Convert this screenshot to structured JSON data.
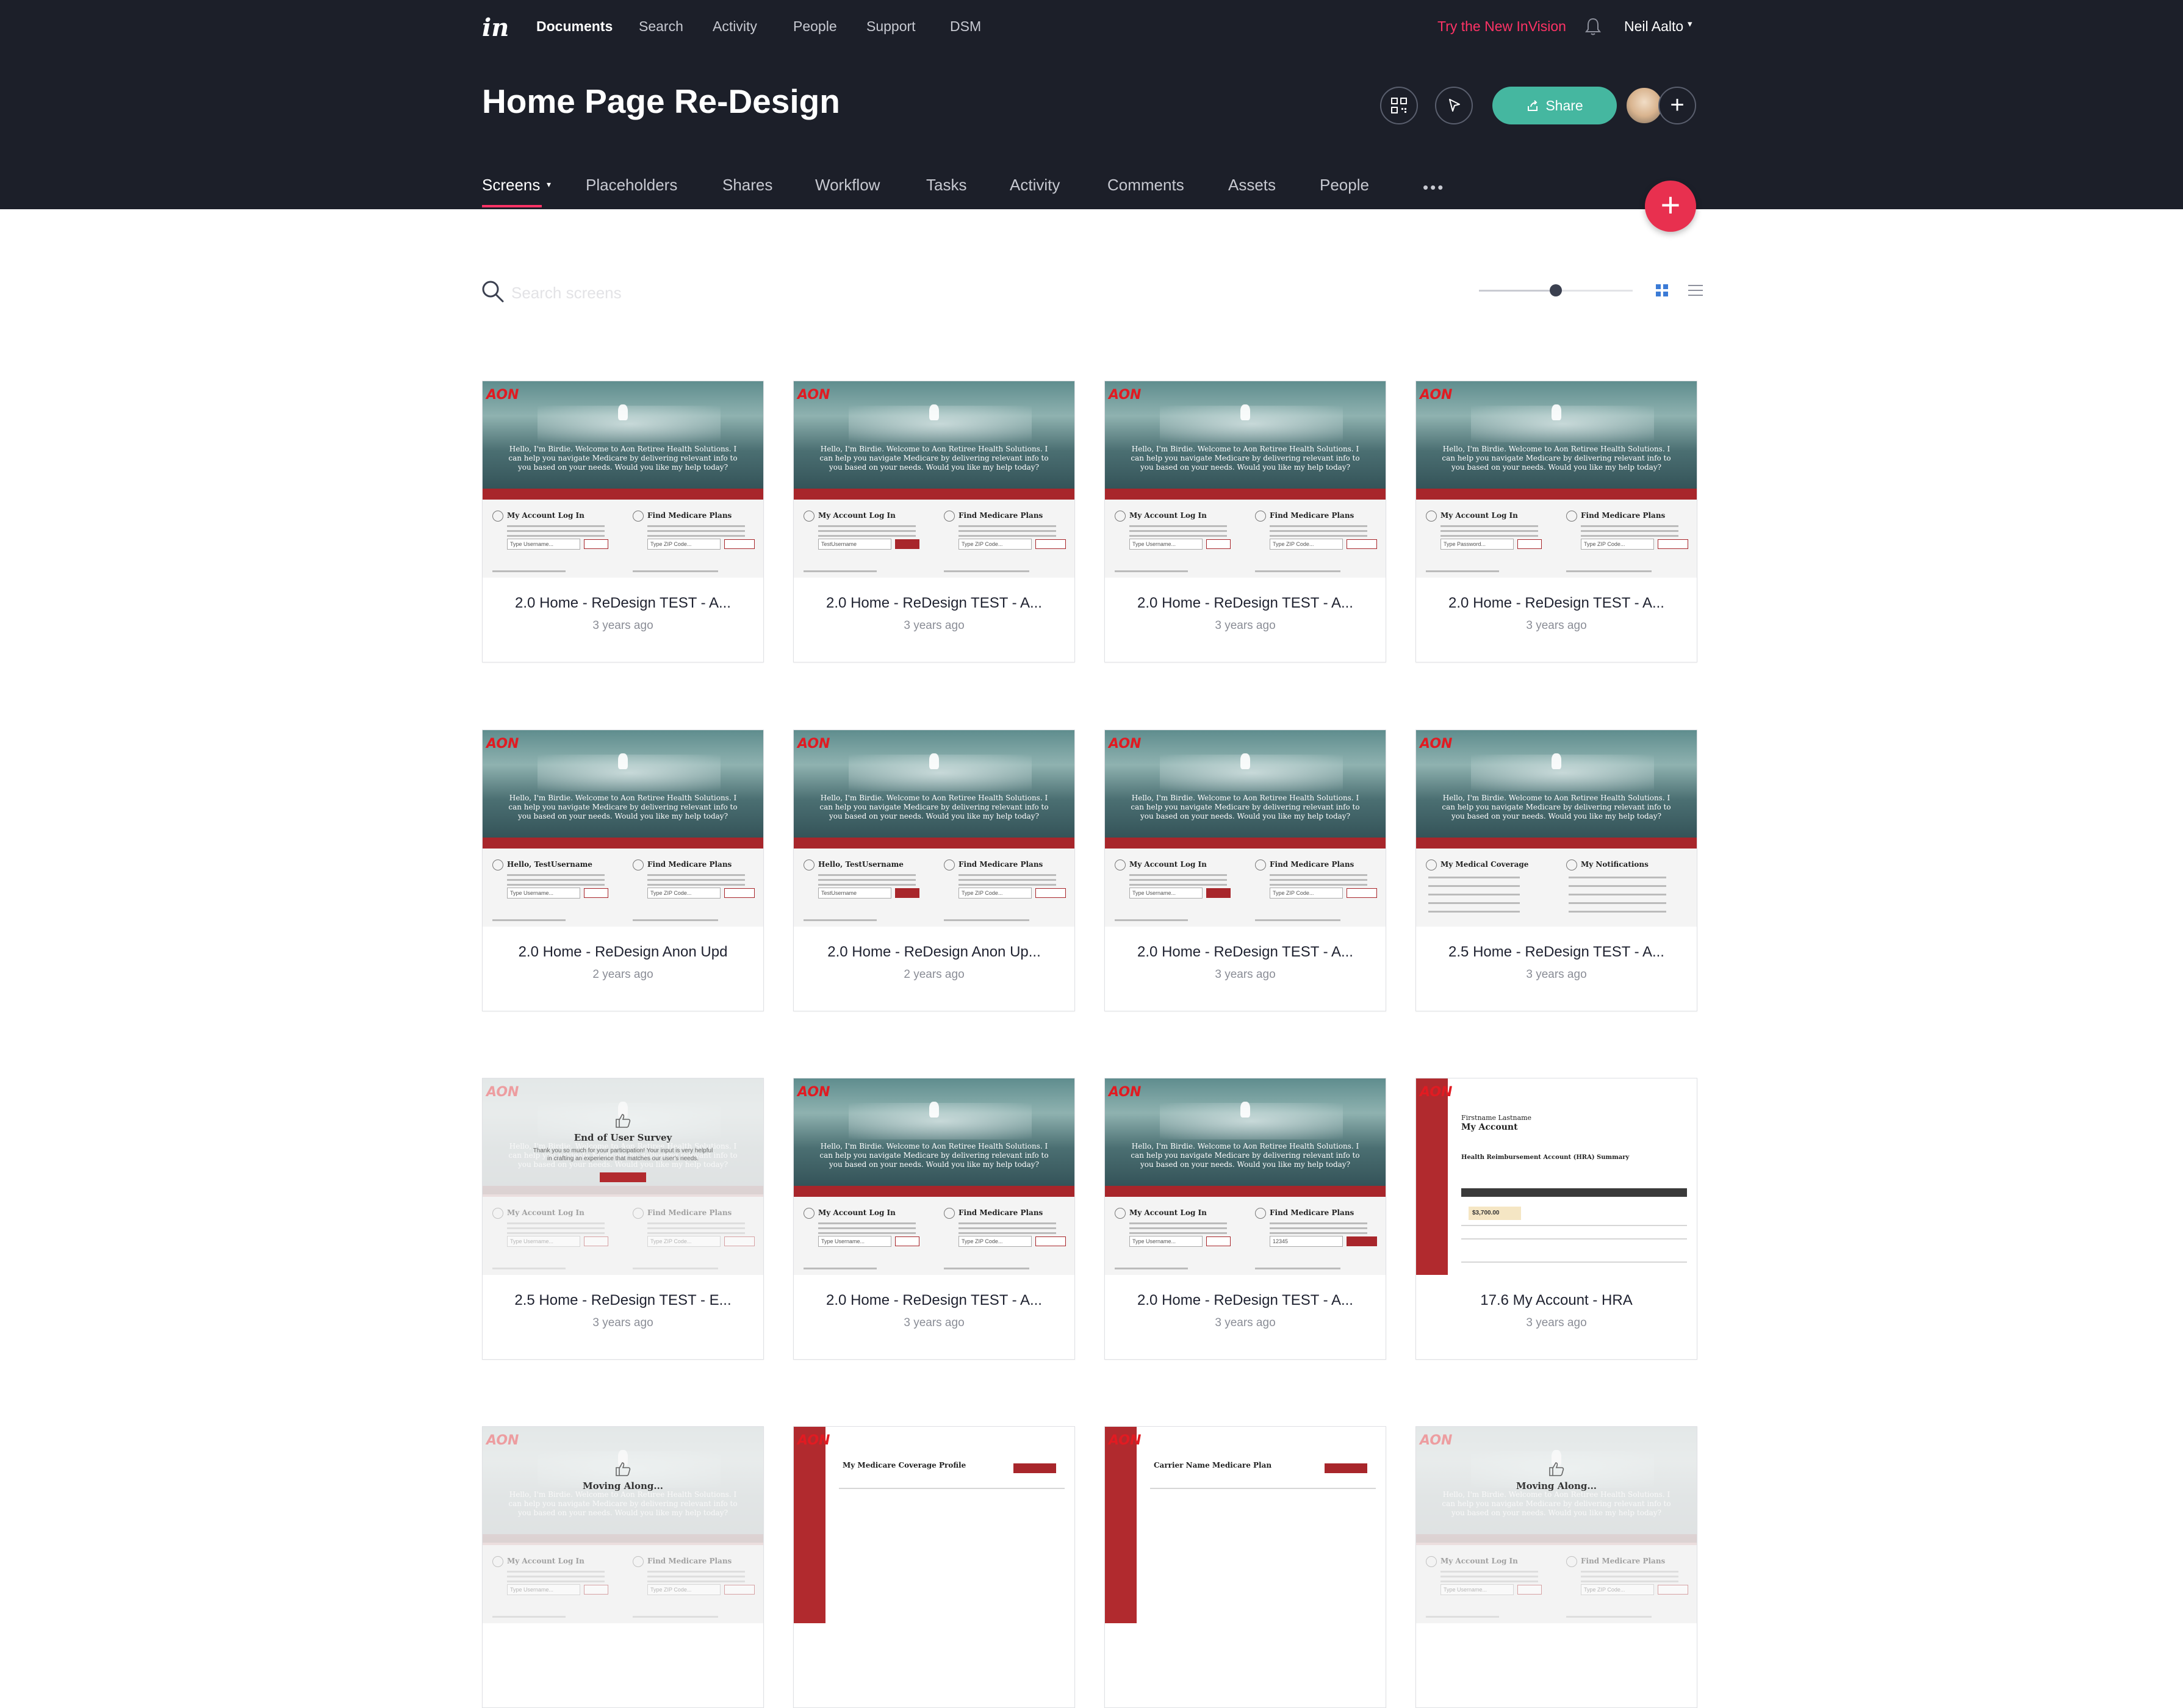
{
  "topnav": {
    "logo": "in",
    "items": [
      "Documents",
      "Search",
      "Activity",
      "People",
      "Support",
      "DSM"
    ],
    "try_new": "Try the New InVision",
    "user_name": "Neil Aalto"
  },
  "project": {
    "title": "Home Page Re-Design",
    "share_label": "Share"
  },
  "tabs": [
    "Screens",
    "Placeholders",
    "Shares",
    "Workflow",
    "Tasks",
    "Activity",
    "Comments",
    "Assets",
    "People"
  ],
  "toolbar": {
    "search_placeholder": "Search screens",
    "zoom_level": 0.5,
    "view": "grid"
  },
  "thumbnail_text": {
    "logo": "AON",
    "welcome": "Hello, I'm Birdie. Welcome to Aon Retiree Health Solutions. I can help you navigate Medicare by delivering relevant info to you based on your needs. Would you like my help today?",
    "login": "My Account Log In",
    "hello_user": "Hello, TestUsername",
    "find_plans": "Find Medicare Plans",
    "medical_coverage": "My Medical Coverage",
    "notifications": "My Notifications",
    "username_field": "Type Username...",
    "password_field": "Type Password...",
    "test_username": "TestUsername",
    "zip_field": "Type ZIP Code...",
    "zip_value": "12345",
    "survey_title": "End of User Survey",
    "survey_sub": "Thank you so much for your participation! Your input is very helpful in crafting an experience that matches our user's needs.",
    "moving_along": "Moving Along...",
    "account_name": "Firstname Lastname",
    "account_title": "My Account",
    "hra_title": "Health Reimbursement Account (HRA) Summary",
    "hra_amount": "$3,700.00",
    "coverage_profile": "My Medicare Coverage Profile",
    "carrier_plan": "Carrier Name Medicare Plan"
  },
  "screens": [
    {
      "name": "2.0 Home - ReDesign TEST - A...",
      "date": "3 years ago",
      "thumb": "login"
    },
    {
      "name": "2.0 Home - ReDesign TEST - A...",
      "date": "3 years ago",
      "thumb": "login-user"
    },
    {
      "name": "2.0 Home - ReDesign TEST - A...",
      "date": "3 years ago",
      "thumb": "login"
    },
    {
      "name": "2.0 Home - ReDesign TEST - A...",
      "date": "3 years ago",
      "thumb": "login-pass"
    },
    {
      "name": "2.0 Home - ReDesign Anon Upd",
      "date": "2 years ago",
      "thumb": "hello"
    },
    {
      "name": "2.0 Home - ReDesign Anon Up...",
      "date": "2 years ago",
      "thumb": "hello-solid"
    },
    {
      "name": "2.0 Home - ReDesign TEST - A...",
      "date": "3 years ago",
      "thumb": "login-solid"
    },
    {
      "name": "2.5 Home - ReDesign TEST - A...",
      "date": "3 years ago",
      "thumb": "coverage"
    },
    {
      "name": "2.5 Home - ReDesign TEST - E...",
      "date": "3 years ago",
      "thumb": "survey"
    },
    {
      "name": "2.0 Home - ReDesign TEST - A...",
      "date": "3 years ago",
      "thumb": "zip"
    },
    {
      "name": "2.0 Home - ReDesign TEST - A...",
      "date": "3 years ago",
      "thumb": "zip-value"
    },
    {
      "name": "17.6 My Account - HRA",
      "date": "3 years ago",
      "thumb": "account"
    },
    {
      "name": "",
      "date": "",
      "thumb": "moving"
    },
    {
      "name": "",
      "date": "",
      "thumb": "profile"
    },
    {
      "name": "",
      "date": "",
      "thumb": "carrier"
    },
    {
      "name": "",
      "date": "",
      "thumb": "moving"
    }
  ],
  "colors": {
    "header_bg": "#1c1f29",
    "accent_pink": "#ff3366",
    "share_green": "#45b7a0",
    "fab_red": "#e8304f",
    "aon_red": "#a8262b"
  }
}
